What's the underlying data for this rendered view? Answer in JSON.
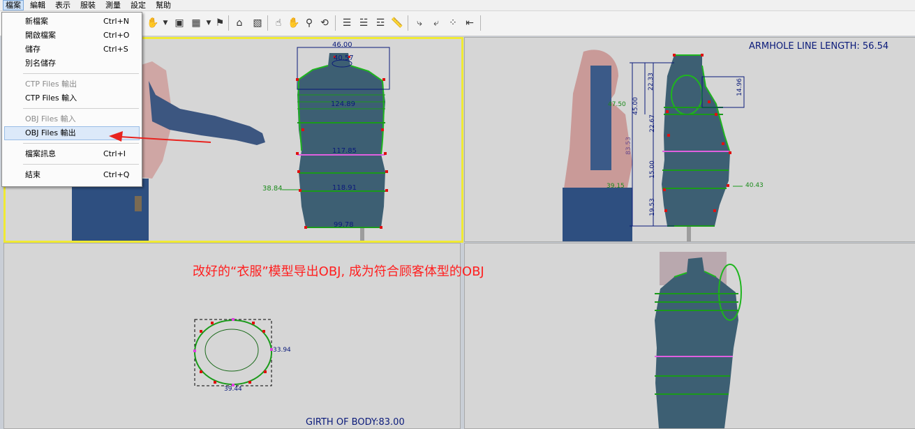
{
  "menubar": [
    "檔案",
    "編輯",
    "表示",
    "服裝",
    "測量",
    "設定",
    "幫助"
  ],
  "file_menu": {
    "items": [
      {
        "label": "新檔案",
        "shortcut": "Ctrl+N",
        "disabled": false
      },
      {
        "label": "開啟檔案",
        "shortcut": "Ctrl+O",
        "disabled": false
      },
      {
        "label": "儲存",
        "shortcut": "Ctrl+S",
        "disabled": false
      },
      {
        "label": "別名儲存",
        "shortcut": "",
        "disabled": false
      },
      {
        "label": "CTP Files 輸出",
        "shortcut": "",
        "disabled": true
      },
      {
        "label": "CTP Files 輸入",
        "shortcut": "",
        "disabled": false
      },
      {
        "label": "OBJ Files 輸入",
        "shortcut": "",
        "disabled": true
      },
      {
        "label": "OBJ Files 輸出",
        "shortcut": "",
        "disabled": false,
        "highlighted": true
      },
      {
        "label": "檔案訊息",
        "shortcut": "Ctrl+I",
        "disabled": false
      },
      {
        "label": "結束",
        "shortcut": "Ctrl+Q",
        "disabled": false
      }
    ]
  },
  "front_view": {
    "measures": [
      "46.00",
      "40.57",
      "124.89",
      "117.85",
      "118.91",
      "99.78",
      "38.84"
    ]
  },
  "side_view": {
    "title": "ARMHOLE LINE LENGTH: 56.54",
    "measures": [
      "22.33",
      "45.00",
      "22.67",
      "83.53",
      "15.00",
      "19.53",
      "47.50",
      "39.15",
      "14.96",
      "40.43"
    ]
  },
  "top_view": {
    "measures": [
      "33.94",
      "39.44"
    ],
    "girth": "GIRTH OF BODY:83.00"
  },
  "annotation": {
    "text": "改好的“衣服”模型导出OBJ, 成为符合顾客体型的OBJ",
    "arrow_color": "#e8231f"
  }
}
